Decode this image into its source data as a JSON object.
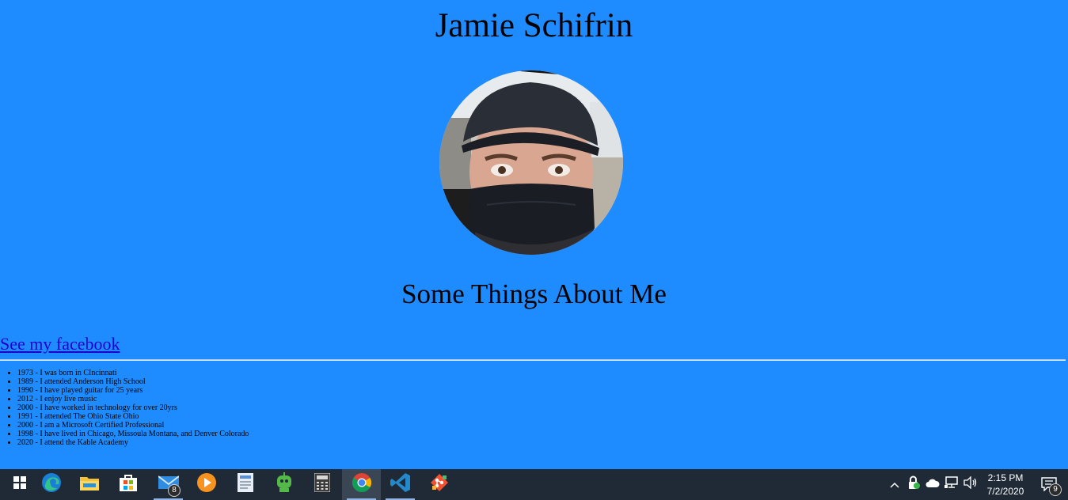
{
  "page": {
    "title": "Jamie Schifrin",
    "subtitle": "Some Things About Me",
    "facebook_link": "See my facebook",
    "facts": [
      "1973 - I was born in CIncinnati",
      "1989 - I attended Anderson High School",
      "1990 - I have played guitar for 25 years",
      "2012 - I enjoy live music",
      "2000 - I have worked in technology for over 20yrs",
      "1991 - I attended The Ohio State Ohio",
      "2000 - I am a Microsoft Certified Professional",
      "1998 - I have lived in Chicago, Missoula Montana, and Denver Colorado",
      "2020 - I attend the Kable Academy"
    ],
    "colors": {
      "background": "#1e8cff",
      "link": "#2200cc"
    }
  },
  "taskbar": {
    "apps": [
      {
        "name": "windows-start",
        "icon": "windows-logo-icon"
      },
      {
        "name": "edge",
        "icon": "edge-browser-icon"
      },
      {
        "name": "file-explorer",
        "icon": "folder-icon"
      },
      {
        "name": "microsoft-store",
        "icon": "store-bag-icon"
      },
      {
        "name": "mail",
        "icon": "mail-icon",
        "badge": "8"
      },
      {
        "name": "media-player",
        "icon": "play-icon"
      },
      {
        "name": "address-book",
        "icon": "contact-card-icon"
      },
      {
        "name": "vpn",
        "icon": "robot-icon"
      },
      {
        "name": "calculator",
        "icon": "calculator-icon"
      },
      {
        "name": "chrome",
        "icon": "chrome-icon"
      },
      {
        "name": "vscode",
        "icon": "vscode-icon"
      },
      {
        "name": "git",
        "icon": "git-icon"
      }
    ],
    "clock": {
      "time": "2:15 PM",
      "date": "7/2/2020"
    },
    "notifications_badge": "9",
    "colors": {
      "background": "#1f2a36"
    }
  }
}
